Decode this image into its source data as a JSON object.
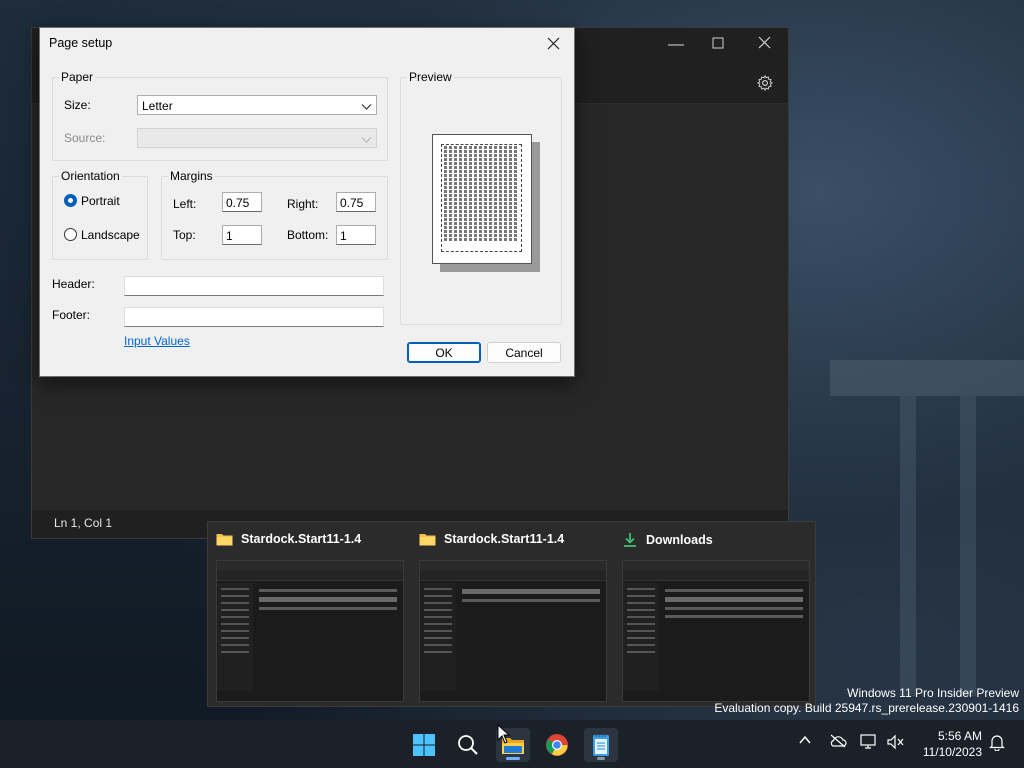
{
  "notepad": {
    "status_position": "Ln 1, Col 1"
  },
  "dialog": {
    "title": "Page setup",
    "paper_group": "Paper",
    "size_label": "Size:",
    "size_value": "Letter",
    "source_label": "Source:",
    "source_value": "",
    "orientation_group": "Orientation",
    "portrait_label": "Portrait",
    "landscape_label": "Landscape",
    "orientation_selected": "Portrait",
    "margins_group": "Margins",
    "left_label": "Left:",
    "left_value": "0.75",
    "right_label": "Right:",
    "right_value": "0.75",
    "top_label": "Top:",
    "top_value": "1",
    "bottom_label": "Bottom:",
    "bottom_value": "1",
    "preview_group": "Preview",
    "header_label": "Header:",
    "header_value": "",
    "footer_label": "Footer:",
    "footer_value": "",
    "input_values_link": "Input Values",
    "ok_label": "OK",
    "cancel_label": "Cancel"
  },
  "flyout": {
    "thumbnails": [
      {
        "title": "Stardock.Start11-1.4",
        "icon": "folder-icon"
      },
      {
        "title": "Stardock.Start11-1.4",
        "icon": "folder-icon"
      },
      {
        "title": "Downloads",
        "icon": "download-icon"
      }
    ]
  },
  "watermark": {
    "line1": "Windows 11 Pro Insider Preview",
    "line2": "Evaluation copy. Build 25947.rs_prerelease.230901-1416"
  },
  "taskbar": {
    "time": "5:56 AM",
    "date": "11/10/2023"
  },
  "colors": {
    "accent": "#005fb8",
    "link": "#0066cc",
    "taskbar_bg": "#1a2129"
  }
}
